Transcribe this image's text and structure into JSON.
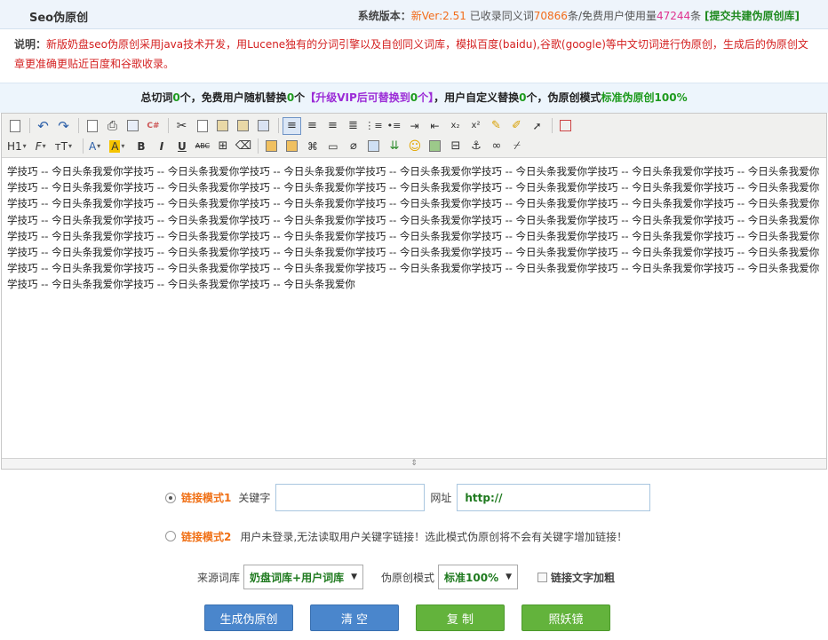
{
  "header": {
    "title": "Seo伪原创",
    "version_label": "系统版本：",
    "version_prefix": "新",
    "version": "Ver:2.51",
    "synonyms_label": "已收录同义词",
    "synonyms_count": "70866",
    "free_users_label": "条/免费用户使用量",
    "free_users_count": "47244",
    "count_suffix": "条",
    "submit_link": "[提交共建伪原创库]"
  },
  "note": {
    "label": "说明：",
    "text": "新版奶盘seo伪原创采用java技术开发，用Lucene独有的分词引擎以及自创同义词库，模拟百度(baidu),谷歌(google)等中文切词进行伪原创，生成后的伪原创文章更准确更贴近百度和谷歌收录。"
  },
  "stats": {
    "total_label": "总切词",
    "total_count": "0",
    "unit": "个",
    "free_label": "，免费用户随机替换",
    "free_count": "0",
    "vip_open": "【升级VIP后可替换到",
    "vip_count": "0",
    "vip_close": "个】",
    "custom_label": "，用户自定义替换",
    "custom_count": "0",
    "mode_label": "个，伪原创模式",
    "mode_value": "标准伪原创100%"
  },
  "toolbar": {
    "row1": [
      "source-icon",
      "undo-icon",
      "redo-icon",
      "preview-icon",
      "print-icon",
      "template-icon",
      "code-icon",
      "cut-icon",
      "copy-icon",
      "paste-icon",
      "paste-text-icon",
      "paste-word-icon",
      "align-left-icon",
      "align-center-icon",
      "align-right-icon",
      "justify-icon",
      "ordered-list-icon",
      "unordered-list-icon",
      "indent-icon",
      "outdent-icon",
      "subscript-icon",
      "superscript-icon",
      "clear-format-icon",
      "select-all-icon",
      "cursor-icon",
      "fullscreen-icon"
    ],
    "heading_label": "H1",
    "font_family_label": "F",
    "font_size_label": "тT",
    "font_color_label": "A",
    "highlight_label": "A",
    "bold_label": "B",
    "italic_label": "I",
    "underline_label": "U",
    "strike_label": "ABC"
  },
  "editor": {
    "content": "学技巧 -- 今日头条我爱你学技巧 -- 今日头条我爱你学技巧 -- 今日头条我爱你学技巧 -- 今日头条我爱你学技巧 -- 今日头条我爱你学技巧 -- 今日头条我爱你学技巧 -- 今日头条我爱你学技巧 -- 今日头条我爱你学技巧 -- 今日头条我爱你学技巧 -- 今日头条我爱你学技巧 -- 今日头条我爱你学技巧 -- 今日头条我爱你学技巧 -- 今日头条我爱你学技巧 -- 今日头条我爱你学技巧 -- 今日头条我爱你学技巧 -- 今日头条我爱你学技巧 -- 今日头条我爱你学技巧 -- 今日头条我爱你学技巧 -- 今日头条我爱你学技巧 -- 今日头条我爱你学技巧 -- 今日头条我爱你学技巧 -- 今日头条我爱你学技巧 -- 今日头条我爱你学技巧 -- 今日头条我爱你学技巧 -- 今日头条我爱你学技巧 -- 今日头条我爱你学技巧 -- 今日头条我爱你学技巧 -- 今日头条我爱你学技巧 -- 今日头条我爱你学技巧 -- 今日头条我爱你学技巧 -- 今日头条我爱你学技巧 -- 今日头条我爱你学技巧 -- 今日头条我爱你学技巧 -- 今日头条我爱你学技巧 -- 今日头条我爱你学技巧 -- 今日头条我爱你学技巧 -- 今日头条我爱你学技巧 -- 今日头条我爱你学技巧 -- 今日头条我爱你学技巧 -- 今日头条我爱你学技巧 -- 今日头条我爱你学技巧 -- 今日头条我爱你学技巧 -- 今日头条我爱你学技巧 -- 今日头条我爱你学技巧 -- 今日头条我爱你学技巧 -- 今日头条我爱你学技巧 -- 今日头条我爱你学技巧 -- 今日头条我爱你学技巧 -- 今日头条我爱你学技巧 -- 今日头条我爱你学技巧 -- 今日头条我爱你学技巧 -- 今日头条我爱你"
  },
  "link_mode1": {
    "label": "链接模式1",
    "keyword_label": "关键字",
    "keyword_value": "",
    "url_label": "网址",
    "url_value": "http://"
  },
  "link_mode2": {
    "label": "链接模式2",
    "message": "用户未登录,无法读取用户关键字链接！选此模式伪原创将不会有关键字增加链接！"
  },
  "options": {
    "source_label": "来源词库",
    "source_value": "奶盘词库+用户词库",
    "mode_label": "伪原创模式",
    "mode_value": "标准100%",
    "bold_links_label": "链接文字加粗"
  },
  "buttons": {
    "generate": "生成伪原创",
    "clear": "清 空",
    "copy": "复 制",
    "check": "照妖镜"
  },
  "colors": {
    "accent_blue": "#4a86cc",
    "accent_green": "#63b33c",
    "note_red": "#d42020",
    "orange": "#f07016"
  }
}
